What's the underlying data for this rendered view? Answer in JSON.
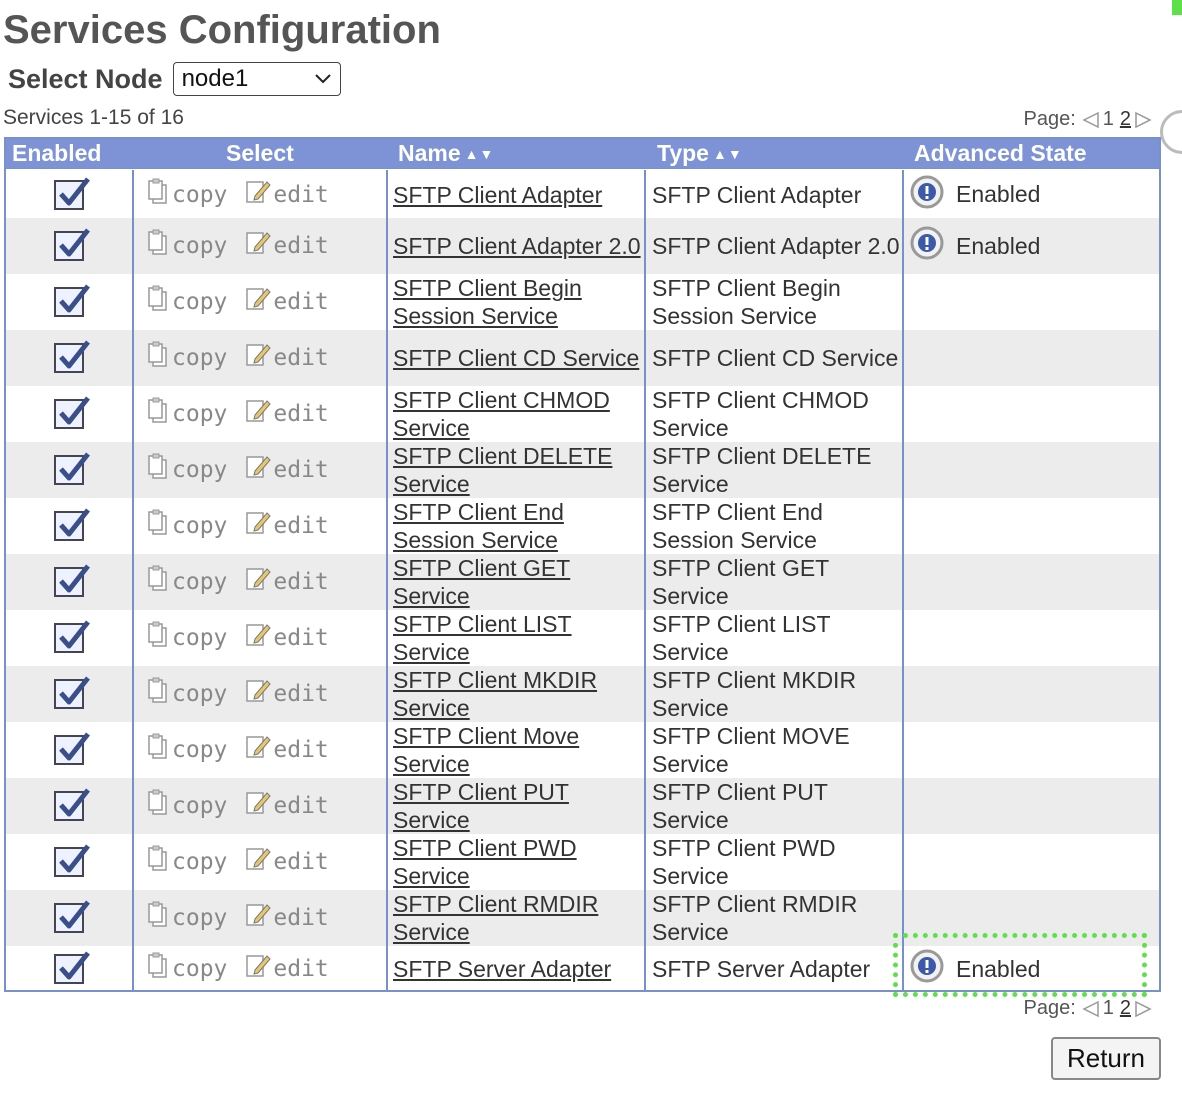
{
  "page_title": "Services Configuration",
  "node_select": {
    "label": "Select Node",
    "value": "node1"
  },
  "services_count": "Services 1-15 of 16",
  "pager": {
    "label": "Page:",
    "current": "1",
    "next": "2"
  },
  "table": {
    "headers": {
      "enabled": "Enabled",
      "select": "Select",
      "name": "Name",
      "type": "Type",
      "state": "Advanced State"
    },
    "copy_label": "copy",
    "edit_label": "edit",
    "rows": [
      {
        "name": "SFTP Client Adapter",
        "type": "SFTP Client Adapter",
        "state": "Enabled"
      },
      {
        "name": "SFTP Client Adapter 2.0",
        "type": "SFTP Client Adapter 2.0",
        "state": "Enabled"
      },
      {
        "name": "SFTP Client Begin Session Service",
        "type": "SFTP Client Begin Session Service",
        "state": ""
      },
      {
        "name": "SFTP Client CD Service",
        "type": "SFTP Client CD Service",
        "state": ""
      },
      {
        "name": "SFTP Client CHMOD Service",
        "type": "SFTP Client CHMOD Service",
        "state": ""
      },
      {
        "name": "SFTP Client DELETE Service",
        "type": "SFTP Client DELETE Service",
        "state": ""
      },
      {
        "name": "SFTP Client End Session Service",
        "type": "SFTP Client End Session Service",
        "state": ""
      },
      {
        "name": "SFTP Client GET Service",
        "type": "SFTP Client GET Service",
        "state": ""
      },
      {
        "name": "SFTP Client LIST Service",
        "type": "SFTP Client LIST Service",
        "state": ""
      },
      {
        "name": "SFTP Client MKDIR Service",
        "type": "SFTP Client MKDIR Service",
        "state": ""
      },
      {
        "name": "SFTP Client Move Service",
        "type": "SFTP Client MOVE Service",
        "state": ""
      },
      {
        "name": "SFTP Client PUT Service",
        "type": "SFTP Client PUT Service",
        "state": ""
      },
      {
        "name": "SFTP Client PWD Service",
        "type": "SFTP Client PWD Service",
        "state": ""
      },
      {
        "name": "SFTP Client RMDIR Service",
        "type": "SFTP Client RMDIR Service",
        "state": ""
      },
      {
        "name": "SFTP Server Adapter",
        "type": "SFTP Server Adapter",
        "state": "Enabled"
      }
    ]
  },
  "return_label": "Return",
  "colors": {
    "header_bg": "#7d93d6",
    "grid_line": "#7890cc",
    "alt_row": "#ececec",
    "highlight": "#5fe04a"
  }
}
